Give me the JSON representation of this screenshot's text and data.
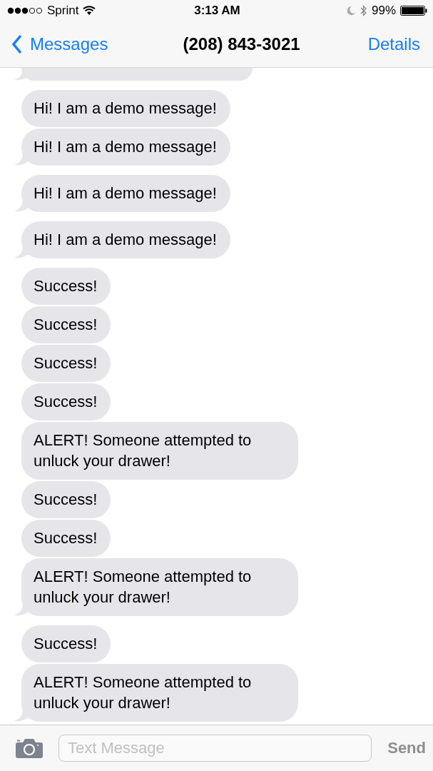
{
  "status_bar": {
    "carrier": "Sprint",
    "time": "3:13 AM",
    "battery": "99%"
  },
  "nav": {
    "back": "Messages",
    "title": "(208) 843-3021",
    "action": "Details"
  },
  "groups": [
    {
      "messages": [
        {
          "kind": "clipped"
        }
      ]
    },
    {
      "messages": [
        {
          "kind": "text",
          "text": "Hi! I am a demo message!"
        },
        {
          "kind": "text",
          "text": "Hi! I am a demo message!"
        }
      ]
    },
    {
      "messages": [
        {
          "kind": "text",
          "text": "Hi! I am a demo message!"
        }
      ]
    },
    {
      "messages": [
        {
          "kind": "text",
          "text": "Hi! I am a demo message!"
        }
      ]
    },
    {
      "messages": [
        {
          "kind": "text",
          "text": "Success!"
        },
        {
          "kind": "text",
          "text": "Success!"
        },
        {
          "kind": "text",
          "text": "Success!"
        },
        {
          "kind": "text",
          "text": "Success!"
        },
        {
          "kind": "text",
          "text": "ALERT! Someone attempted to unluck your drawer!"
        },
        {
          "kind": "text",
          "text": "Success!"
        },
        {
          "kind": "text",
          "text": "Success!"
        },
        {
          "kind": "text",
          "text": "ALERT! Someone attempted to unluck your drawer!"
        }
      ]
    },
    {
      "messages": [
        {
          "kind": "text",
          "text": "Success!"
        },
        {
          "kind": "text",
          "text": "ALERT! Someone attempted to unluck your drawer!"
        }
      ]
    }
  ],
  "composer": {
    "placeholder": "Text Message",
    "send": "Send"
  }
}
